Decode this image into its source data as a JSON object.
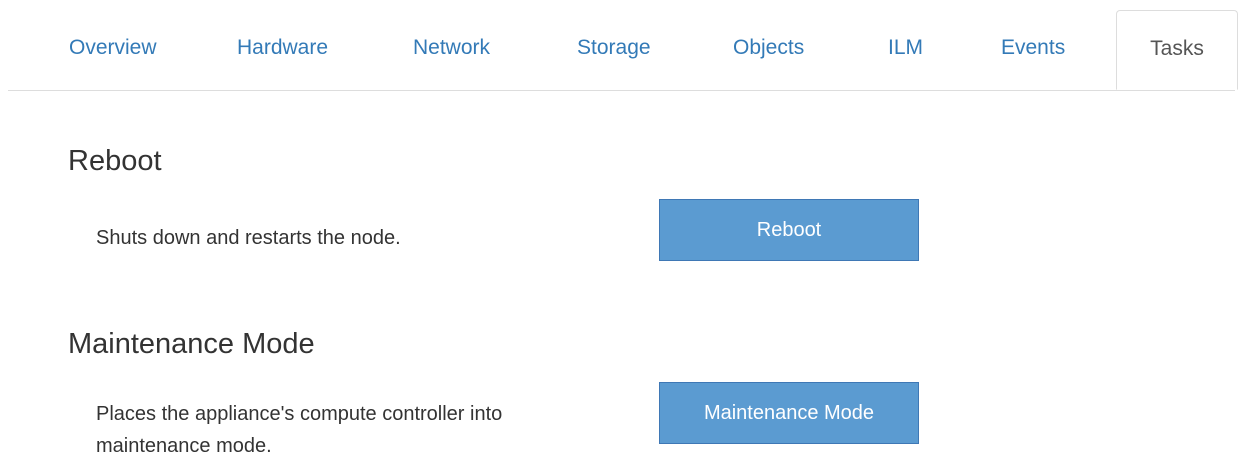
{
  "tabs": [
    {
      "label": "Overview"
    },
    {
      "label": "Hardware"
    },
    {
      "label": "Network"
    },
    {
      "label": "Storage"
    },
    {
      "label": "Objects"
    },
    {
      "label": "ILM"
    },
    {
      "label": "Events"
    },
    {
      "label": "Tasks",
      "active": true
    }
  ],
  "sections": {
    "reboot": {
      "title": "Reboot",
      "description": "Shuts down and restarts the node.",
      "button_label": "Reboot"
    },
    "maintenance": {
      "title": "Maintenance Mode",
      "description": "Places the appliance's compute controller into maintenance mode.",
      "button_label": "Maintenance Mode"
    }
  },
  "colors": {
    "link": "#337ab7",
    "button_bg": "#5b9bd1",
    "button_border": "#3f78b5",
    "text": "#333333"
  }
}
